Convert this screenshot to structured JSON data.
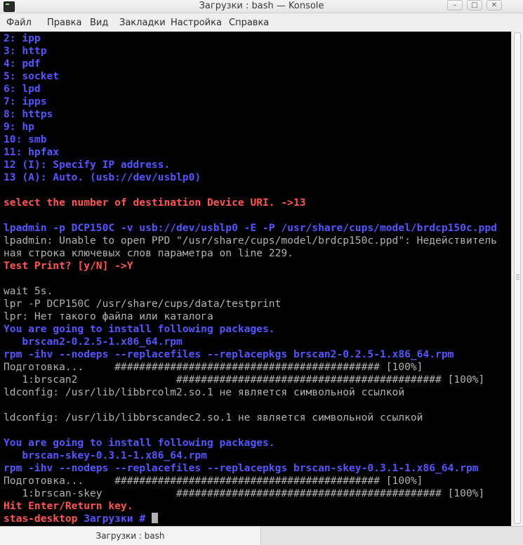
{
  "window": {
    "title": "Загрузки : bash — Konsole",
    "minimize_glyph": "–",
    "maximize_glyph": "□",
    "close_glyph": "✕"
  },
  "menu": {
    "items": [
      "Файл",
      "Правка",
      "Вид",
      "Закладки",
      "Настройка",
      "Справка"
    ]
  },
  "terminal": {
    "lines": [
      {
        "text": "2: ipp",
        "color": "blue"
      },
      {
        "text": "3: http",
        "color": "blue"
      },
      {
        "text": "4: pdf",
        "color": "blue"
      },
      {
        "text": "5: socket",
        "color": "blue"
      },
      {
        "text": "6: lpd",
        "color": "blue"
      },
      {
        "text": "7: ipps",
        "color": "blue"
      },
      {
        "text": "8: https",
        "color": "blue"
      },
      {
        "text": "9: hp",
        "color": "blue"
      },
      {
        "text": "10: smb",
        "color": "blue"
      },
      {
        "text": "11: hpfax",
        "color": "blue"
      },
      {
        "text": "12 (I): Specify IP address.",
        "color": "blue"
      },
      {
        "text": "13 (A): Auto. (usb://dev/usblp0)",
        "color": "blue"
      },
      {
        "text": "",
        "color": "gray"
      },
      {
        "text": "select the number of destination Device URI. ->13",
        "color": "red"
      },
      {
        "text": "",
        "color": "gray"
      },
      {
        "text": "lpadmin -p DCP150C -v usb://dev/usblp0 -E -P /usr/share/cups/model/brdcp150c.ppd",
        "color": "blue"
      },
      {
        "text": "lpadmin: Unable to open PPD \"/usr/share/cups/model/brdcp150c.ppd\": Недействитель",
        "color": "gray"
      },
      {
        "text": "ная строка ключевых слов параметра on line 229.",
        "color": "gray"
      },
      {
        "text": "Test Print? [y/N] ->Y",
        "color": "red"
      },
      {
        "text": "",
        "color": "gray"
      },
      {
        "text": "wait 5s.",
        "color": "gray"
      },
      {
        "text": "lpr -P DCP150C /usr/share/cups/data/testprint",
        "color": "gray"
      },
      {
        "text": "lpr: Нет такого файла или каталога",
        "color": "gray"
      },
      {
        "text": "You are going to install following packages.",
        "color": "blue"
      },
      {
        "text": "   brscan2-0.2.5-1.x86_64.rpm",
        "color": "blue"
      },
      {
        "text": "rpm -ihv --nodeps --replacefiles --replacepkgs brscan2-0.2.5-1.x86_64.rpm",
        "color": "blue"
      },
      {
        "text": "Подготовка...     ########################################### [100%]",
        "color": "gray"
      },
      {
        "text": "   1:brscan2                ########################################### [100%]",
        "color": "gray"
      },
      {
        "text": "ldconfig: /usr/lib/libbrcolm2.so.1 не является символьной ссылкой",
        "color": "gray"
      },
      {
        "text": "",
        "color": "gray"
      },
      {
        "text": "ldconfig: /usr/lib/libbrscandec2.so.1 не является символьной ссылкой",
        "color": "gray"
      },
      {
        "text": "",
        "color": "gray"
      },
      {
        "text": "You are going to install following packages.",
        "color": "blue"
      },
      {
        "text": "   brscan-skey-0.3.1-1.x86_64.rpm",
        "color": "blue"
      },
      {
        "text": "rpm -ihv --nodeps --replacefiles --replacepkgs brscan-skey-0.3.1-1.x86_64.rpm",
        "color": "blue"
      },
      {
        "text": "Подготовка...     ########################################### [100%]",
        "color": "gray"
      },
      {
        "text": "   1:brscan-skey            ########################################### [100%]",
        "color": "gray"
      },
      {
        "text": "Hit Enter/Return key.",
        "color": "red"
      }
    ],
    "prompt": {
      "host": "stas-desktop",
      "directory": "Загрузки",
      "symbol": "#"
    },
    "colors": {
      "blue": "#5555ff",
      "red": "#ff5555",
      "gray": "#b2b2b2",
      "background": "#000000"
    }
  },
  "tabs": [
    {
      "label": "Загрузки : bash",
      "active": true
    }
  ]
}
